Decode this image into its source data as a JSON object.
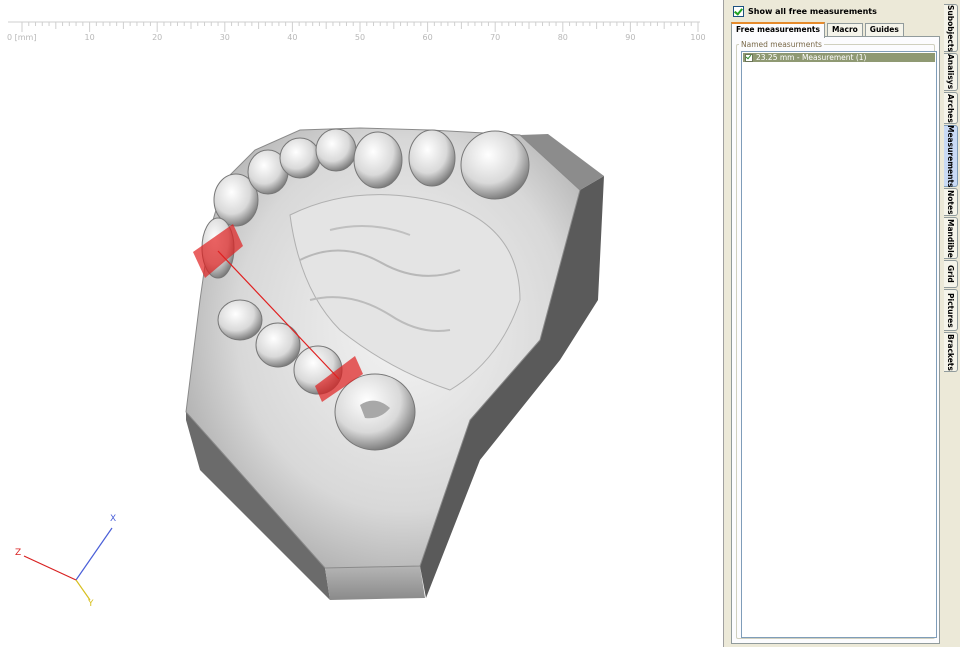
{
  "ruler": {
    "unit_label": "0 [mm]",
    "ticks": [
      "10",
      "20",
      "30",
      "40",
      "50",
      "60",
      "70",
      "80",
      "90",
      "100"
    ]
  },
  "axes": {
    "x": "X",
    "y": "Y",
    "z": "Z"
  },
  "panel": {
    "show_all_label": "Show all free measurements",
    "tabs": [
      {
        "label": "Free measurements",
        "active": true
      },
      {
        "label": "Macro",
        "active": false
      },
      {
        "label": "Guides",
        "active": false
      }
    ],
    "group_title": "Named measurments",
    "measurements": [
      {
        "label": "23.25 mm - Measurement (1)",
        "checked": true
      }
    ]
  },
  "side_tabs": [
    {
      "label": "Subobjects",
      "active": false
    },
    {
      "label": "Analisys",
      "active": false
    },
    {
      "label": "Arches",
      "active": false
    },
    {
      "label": "Measurements",
      "active": true
    },
    {
      "label": "Notes",
      "active": false
    },
    {
      "label": "Mandible",
      "active": false
    },
    {
      "label": "Grid",
      "active": false
    },
    {
      "label": "Pictures",
      "active": false
    },
    {
      "label": "Brackets",
      "active": false
    }
  ],
  "colors": {
    "measurement": "#e02020",
    "selection": "#8f9973",
    "axis_x": "#4a5fd8",
    "axis_y": "#d8c020",
    "axis_z": "#d82020"
  }
}
